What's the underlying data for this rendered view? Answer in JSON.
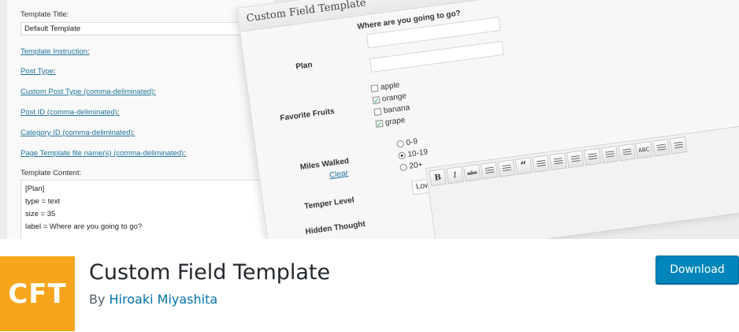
{
  "banner": {
    "settings": {
      "template_title_label": "Template Title:",
      "template_title_value": "Default Template",
      "links": [
        "Template Instruction",
        "Post Type",
        "Custom Post Type (comma-deliminated)",
        "Post ID (comma-deliminated)",
        "Category ID (comma-deliminated)",
        "Page Template file name(s) (comma-deliminated)"
      ],
      "template_content_label": "Template Content:",
      "template_content_lines": [
        "[Plan]",
        "type = text",
        "size = 35",
        "label = Where are you going to go?"
      ]
    },
    "card": {
      "title": "Custom Field Template",
      "plan_label": "Plan",
      "plan_question": "Where are you going to go?",
      "fruits_label": "Favorite Fruits",
      "fruits": [
        {
          "label": "apple",
          "checked": false
        },
        {
          "label": "orange",
          "checked": true
        },
        {
          "label": "banana",
          "checked": false
        },
        {
          "label": "grape",
          "checked": true
        }
      ],
      "miles_label": "Miles Walked",
      "clear_label": "Clear",
      "miles_options": [
        {
          "label": "0-9",
          "selected": false
        },
        {
          "label": "10-19",
          "selected": true
        },
        {
          "label": "20+",
          "selected": false
        }
      ],
      "temper_label": "Temper Level",
      "temper_value": "Low",
      "hidden_label": "Hidden Thought",
      "editor_bold": "B",
      "editor_italic": "I",
      "editor_strike": "abc",
      "editor_quote": "“",
      "editor_spell": "ABC"
    }
  },
  "plugin": {
    "icon_text": "CFT",
    "name": "Custom Field Template",
    "by_prefix": "By",
    "author": "Hiroaki Miyashita",
    "download_label": "Download",
    "colors": {
      "icon": "#f7a51c",
      "button": "#0085ba",
      "link": "#0073aa"
    }
  }
}
